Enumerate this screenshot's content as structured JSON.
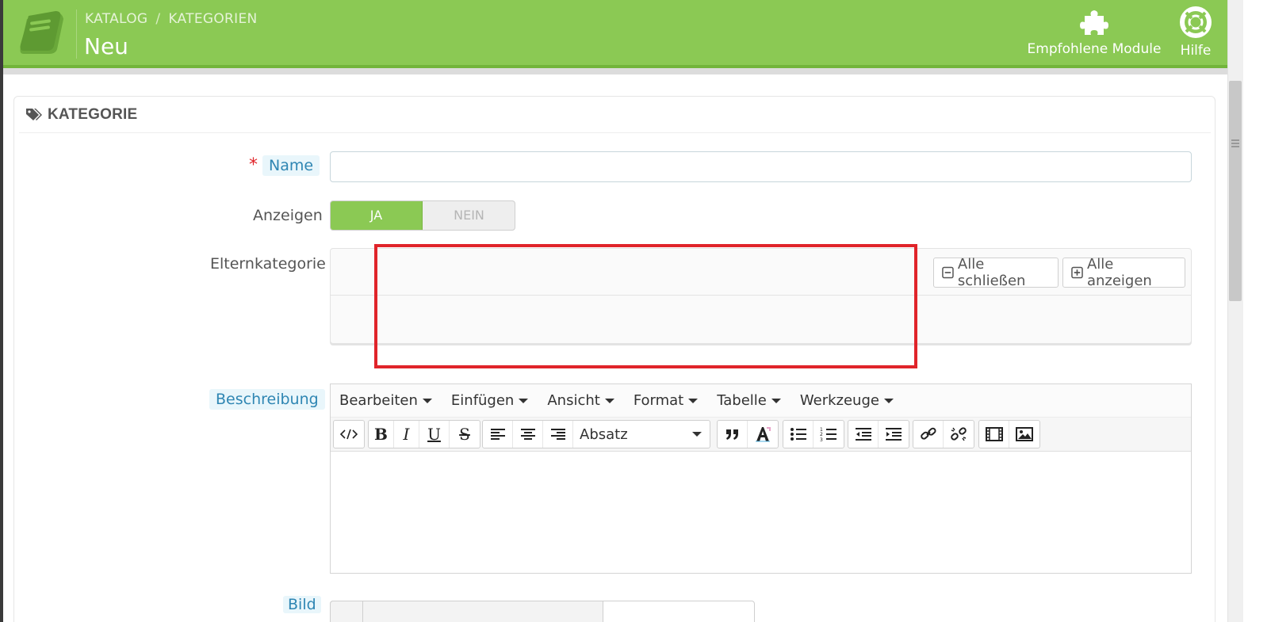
{
  "header": {
    "breadcrumb": [
      "KATALOG",
      "KATEGORIEN"
    ],
    "breadcrumb_separator": "/",
    "title": "Neu",
    "modules_label": "Empfohlene Module",
    "help_label": "Hilfe",
    "bg_color": "#8bc954"
  },
  "panel": {
    "heading": "KATEGORIE",
    "heading_icon": "tags-icon"
  },
  "form": {
    "name_label": "Name",
    "required_mark": "*",
    "name_value": "",
    "show_label": "Anzeigen",
    "switch_yes": "JA",
    "switch_no": "NEIN",
    "switch_selected": "JA",
    "parent_label": "Elternkategorie",
    "collapse_all": "Alle schließen",
    "expand_all": "Alle anzeigen",
    "description_label": "Beschreibung",
    "image_label": "Bild"
  },
  "editor": {
    "menus": [
      "Bearbeiten",
      "Einfügen",
      "Ansicht",
      "Format",
      "Tabelle",
      "Werkzeuge"
    ],
    "format_select": "Absatz",
    "content": ""
  },
  "colors": {
    "accent": "#8bc954",
    "highlight_border": "#e0242a",
    "label_highlight": "#2f86b3"
  }
}
